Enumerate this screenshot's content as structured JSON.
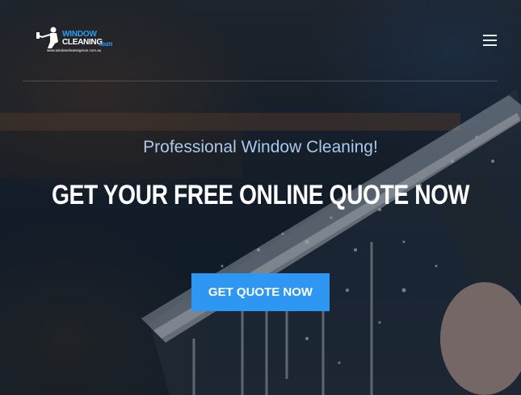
{
  "header": {
    "logo": {
      "word1": "WINDOW",
      "word2": "CLEANING",
      "word3": "man",
      "url": "www.windowcleaningman.com.au"
    },
    "menu_icon": "hamburger-menu-icon"
  },
  "hero": {
    "subtitle": "Professional Window Cleaning!",
    "headline": "GET YOUR FREE ONLINE QUOTE NOW",
    "cta_label": "GET QUOTE NOW",
    "background_image": "squeegee-window-cleaning-photo"
  },
  "colors": {
    "accent": "#2e96f3",
    "subtitle": "#a9c9ec",
    "logo_blue": "#2a9df4"
  }
}
